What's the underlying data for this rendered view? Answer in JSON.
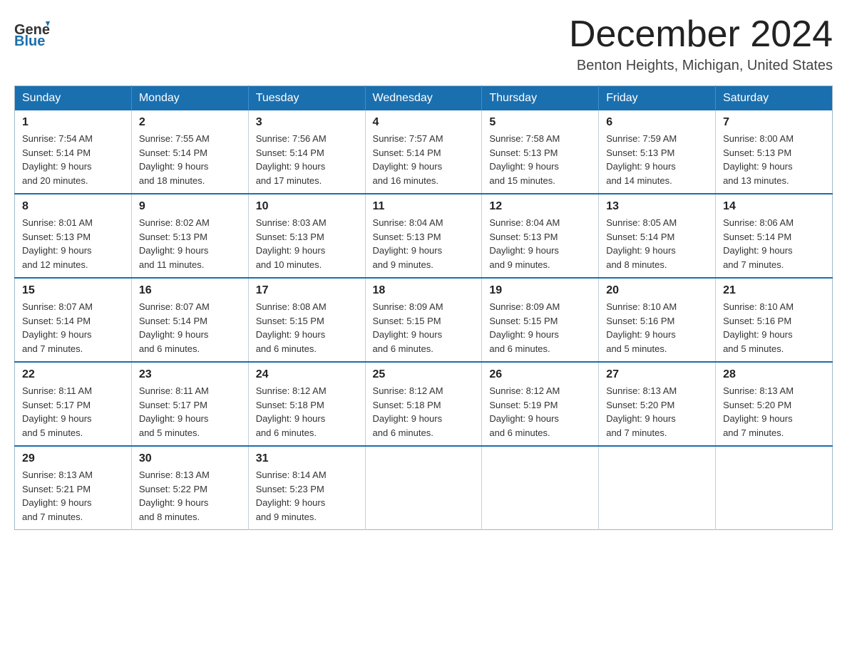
{
  "header": {
    "logo_general": "General",
    "logo_blue": "Blue",
    "month_title": "December 2024",
    "location": "Benton Heights, Michigan, United States"
  },
  "weekdays": [
    "Sunday",
    "Monday",
    "Tuesday",
    "Wednesday",
    "Thursday",
    "Friday",
    "Saturday"
  ],
  "weeks": [
    [
      {
        "day": "1",
        "sunrise": "Sunrise: 7:54 AM",
        "sunset": "Sunset: 5:14 PM",
        "daylight": "Daylight: 9 hours",
        "daylight2": "and 20 minutes."
      },
      {
        "day": "2",
        "sunrise": "Sunrise: 7:55 AM",
        "sunset": "Sunset: 5:14 PM",
        "daylight": "Daylight: 9 hours",
        "daylight2": "and 18 minutes."
      },
      {
        "day": "3",
        "sunrise": "Sunrise: 7:56 AM",
        "sunset": "Sunset: 5:14 PM",
        "daylight": "Daylight: 9 hours",
        "daylight2": "and 17 minutes."
      },
      {
        "day": "4",
        "sunrise": "Sunrise: 7:57 AM",
        "sunset": "Sunset: 5:14 PM",
        "daylight": "Daylight: 9 hours",
        "daylight2": "and 16 minutes."
      },
      {
        "day": "5",
        "sunrise": "Sunrise: 7:58 AM",
        "sunset": "Sunset: 5:13 PM",
        "daylight": "Daylight: 9 hours",
        "daylight2": "and 15 minutes."
      },
      {
        "day": "6",
        "sunrise": "Sunrise: 7:59 AM",
        "sunset": "Sunset: 5:13 PM",
        "daylight": "Daylight: 9 hours",
        "daylight2": "and 14 minutes."
      },
      {
        "day": "7",
        "sunrise": "Sunrise: 8:00 AM",
        "sunset": "Sunset: 5:13 PM",
        "daylight": "Daylight: 9 hours",
        "daylight2": "and 13 minutes."
      }
    ],
    [
      {
        "day": "8",
        "sunrise": "Sunrise: 8:01 AM",
        "sunset": "Sunset: 5:13 PM",
        "daylight": "Daylight: 9 hours",
        "daylight2": "and 12 minutes."
      },
      {
        "day": "9",
        "sunrise": "Sunrise: 8:02 AM",
        "sunset": "Sunset: 5:13 PM",
        "daylight": "Daylight: 9 hours",
        "daylight2": "and 11 minutes."
      },
      {
        "day": "10",
        "sunrise": "Sunrise: 8:03 AM",
        "sunset": "Sunset: 5:13 PM",
        "daylight": "Daylight: 9 hours",
        "daylight2": "and 10 minutes."
      },
      {
        "day": "11",
        "sunrise": "Sunrise: 8:04 AM",
        "sunset": "Sunset: 5:13 PM",
        "daylight": "Daylight: 9 hours",
        "daylight2": "and 9 minutes."
      },
      {
        "day": "12",
        "sunrise": "Sunrise: 8:04 AM",
        "sunset": "Sunset: 5:13 PM",
        "daylight": "Daylight: 9 hours",
        "daylight2": "and 9 minutes."
      },
      {
        "day": "13",
        "sunrise": "Sunrise: 8:05 AM",
        "sunset": "Sunset: 5:14 PM",
        "daylight": "Daylight: 9 hours",
        "daylight2": "and 8 minutes."
      },
      {
        "day": "14",
        "sunrise": "Sunrise: 8:06 AM",
        "sunset": "Sunset: 5:14 PM",
        "daylight": "Daylight: 9 hours",
        "daylight2": "and 7 minutes."
      }
    ],
    [
      {
        "day": "15",
        "sunrise": "Sunrise: 8:07 AM",
        "sunset": "Sunset: 5:14 PM",
        "daylight": "Daylight: 9 hours",
        "daylight2": "and 7 minutes."
      },
      {
        "day": "16",
        "sunrise": "Sunrise: 8:07 AM",
        "sunset": "Sunset: 5:14 PM",
        "daylight": "Daylight: 9 hours",
        "daylight2": "and 6 minutes."
      },
      {
        "day": "17",
        "sunrise": "Sunrise: 8:08 AM",
        "sunset": "Sunset: 5:15 PM",
        "daylight": "Daylight: 9 hours",
        "daylight2": "and 6 minutes."
      },
      {
        "day": "18",
        "sunrise": "Sunrise: 8:09 AM",
        "sunset": "Sunset: 5:15 PM",
        "daylight": "Daylight: 9 hours",
        "daylight2": "and 6 minutes."
      },
      {
        "day": "19",
        "sunrise": "Sunrise: 8:09 AM",
        "sunset": "Sunset: 5:15 PM",
        "daylight": "Daylight: 9 hours",
        "daylight2": "and 6 minutes."
      },
      {
        "day": "20",
        "sunrise": "Sunrise: 8:10 AM",
        "sunset": "Sunset: 5:16 PM",
        "daylight": "Daylight: 9 hours",
        "daylight2": "and 5 minutes."
      },
      {
        "day": "21",
        "sunrise": "Sunrise: 8:10 AM",
        "sunset": "Sunset: 5:16 PM",
        "daylight": "Daylight: 9 hours",
        "daylight2": "and 5 minutes."
      }
    ],
    [
      {
        "day": "22",
        "sunrise": "Sunrise: 8:11 AM",
        "sunset": "Sunset: 5:17 PM",
        "daylight": "Daylight: 9 hours",
        "daylight2": "and 5 minutes."
      },
      {
        "day": "23",
        "sunrise": "Sunrise: 8:11 AM",
        "sunset": "Sunset: 5:17 PM",
        "daylight": "Daylight: 9 hours",
        "daylight2": "and 5 minutes."
      },
      {
        "day": "24",
        "sunrise": "Sunrise: 8:12 AM",
        "sunset": "Sunset: 5:18 PM",
        "daylight": "Daylight: 9 hours",
        "daylight2": "and 6 minutes."
      },
      {
        "day": "25",
        "sunrise": "Sunrise: 8:12 AM",
        "sunset": "Sunset: 5:18 PM",
        "daylight": "Daylight: 9 hours",
        "daylight2": "and 6 minutes."
      },
      {
        "day": "26",
        "sunrise": "Sunrise: 8:12 AM",
        "sunset": "Sunset: 5:19 PM",
        "daylight": "Daylight: 9 hours",
        "daylight2": "and 6 minutes."
      },
      {
        "day": "27",
        "sunrise": "Sunrise: 8:13 AM",
        "sunset": "Sunset: 5:20 PM",
        "daylight": "Daylight: 9 hours",
        "daylight2": "and 7 minutes."
      },
      {
        "day": "28",
        "sunrise": "Sunrise: 8:13 AM",
        "sunset": "Sunset: 5:20 PM",
        "daylight": "Daylight: 9 hours",
        "daylight2": "and 7 minutes."
      }
    ],
    [
      {
        "day": "29",
        "sunrise": "Sunrise: 8:13 AM",
        "sunset": "Sunset: 5:21 PM",
        "daylight": "Daylight: 9 hours",
        "daylight2": "and 7 minutes."
      },
      {
        "day": "30",
        "sunrise": "Sunrise: 8:13 AM",
        "sunset": "Sunset: 5:22 PM",
        "daylight": "Daylight: 9 hours",
        "daylight2": "and 8 minutes."
      },
      {
        "day": "31",
        "sunrise": "Sunrise: 8:14 AM",
        "sunset": "Sunset: 5:23 PM",
        "daylight": "Daylight: 9 hours",
        "daylight2": "and 9 minutes."
      },
      null,
      null,
      null,
      null
    ]
  ]
}
